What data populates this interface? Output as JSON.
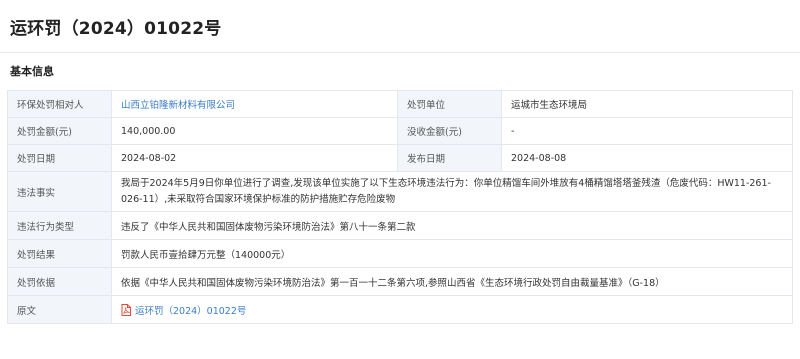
{
  "title": "运环罚（2024）01022号",
  "section_title": "基本信息",
  "rows": {
    "party": {
      "label": "环保处罚相对人",
      "value": "山西立铂隆新材料有限公司"
    },
    "org": {
      "label": "处罚单位",
      "value": "运城市生态环境局"
    },
    "fine": {
      "label": "处罚金额(元)",
      "value": "140,000.00"
    },
    "confiscation": {
      "label": "没收金额(元)",
      "value": "-"
    },
    "penalty_date": {
      "label": "处罚日期",
      "value": "2024-08-02"
    },
    "publish_date": {
      "label": "发布日期",
      "value": "2024-08-08"
    },
    "facts": {
      "label": "违法事实",
      "value": "我局于2024年5月9日你单位进行了调查,发现该单位实施了以下生态环境违法行为：你单位精馏车间外堆放有4桶精馏塔塔釜残渣（危废代码：HW11-261-026-11）,未采取符合国家环境保护标准的防护措施贮存危险废物"
    },
    "violation_type": {
      "label": "违法行为类型",
      "value": "违反了《中华人民共和国固体废物污染环境防治法》第八十一条第二款"
    },
    "result": {
      "label": "处罚结果",
      "value": "罚款人民币壹拾肆万元整（140000元）"
    },
    "basis": {
      "label": "处罚依据",
      "value": "依据《中华人民共和国固体废物污染环境防治法》第一百一十二条第六项,参照山西省《生态环境行政处罚自由裁量基准》（G-18）"
    },
    "original": {
      "label": "原文",
      "value": "运环罚（2024）01022号",
      "icon": "pdf-icon"
    }
  },
  "colors": {
    "link": "#3b7cc9",
    "label_bg": "#f2f6fa",
    "border": "#e3e8ef",
    "pdf_red": "#e04b3a"
  }
}
